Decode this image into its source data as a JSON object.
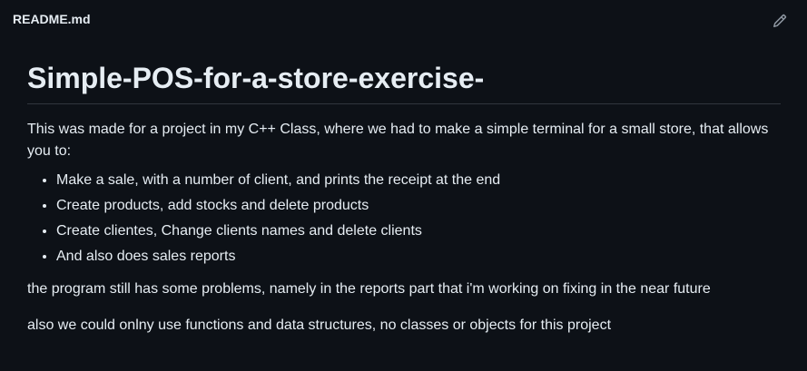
{
  "header": {
    "filename": "README.md",
    "edit_icon": "pencil-icon"
  },
  "readme": {
    "title": "Simple-POS-for-a-store-exercise-",
    "intro": "This was made for a project in my C++ Class, where we had to make a simple terminal for a small store, that allows you to:",
    "features": [
      "Make a sale, with a number of client, and prints the receipt at the end",
      "Create products, add stocks and delete products",
      "Create clientes, Change clients names and delete clients",
      "And also does sales reports"
    ],
    "note_problems": "the program still has some problems, namely in the reports part that i'm working on fixing in the near future",
    "note_constraints": "also we could onlny use functions and data structures, no classes or objects for this project"
  },
  "colors": {
    "background": "#0d1117",
    "text": "#e6edf3",
    "muted": "#8d96a0",
    "divider": "#30363d"
  }
}
